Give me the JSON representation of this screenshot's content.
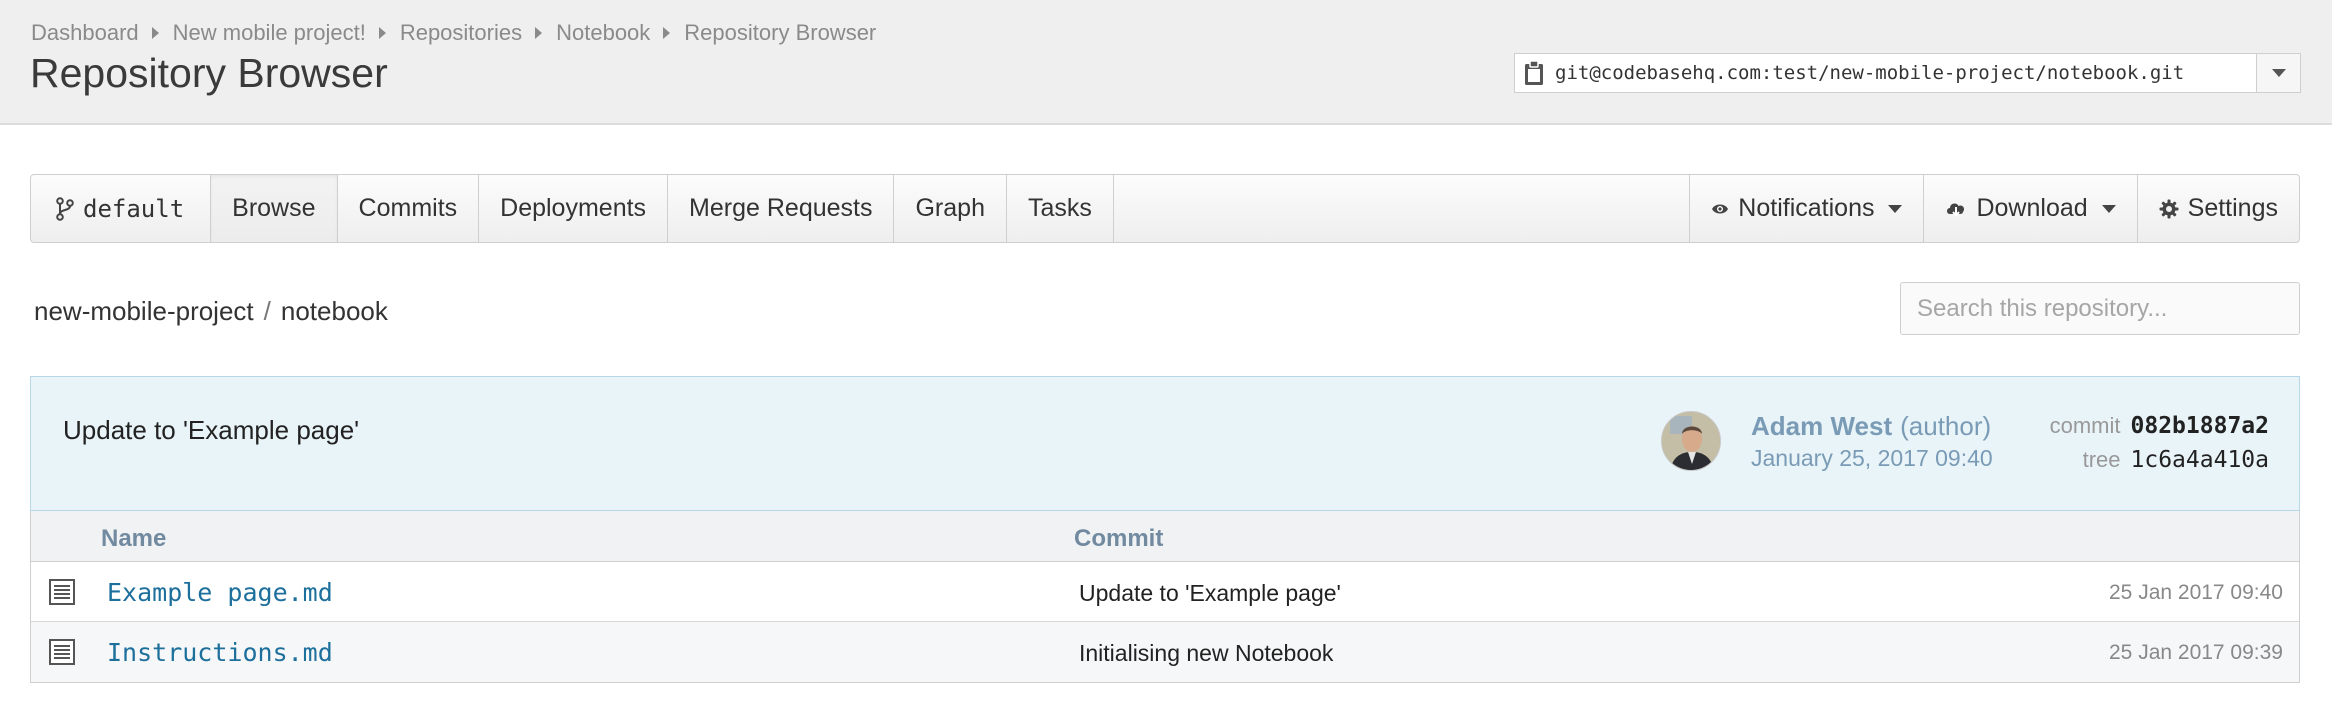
{
  "breadcrumb": [
    "Dashboard",
    "New mobile project!",
    "Repositories",
    "Notebook",
    "Repository Browser"
  ],
  "page_title": "Repository Browser",
  "clone": {
    "url": "git@codebasehq.com:test/new-mobile-project/notebook.git",
    "clip_icon": "clipboard-icon",
    "dropdown_icon": "caret-down-icon"
  },
  "nav": {
    "branch": "default",
    "branch_icon": "git-branch-icon",
    "tabs": [
      "Browse",
      "Commits",
      "Deployments",
      "Merge Requests",
      "Graph",
      "Tasks"
    ],
    "active_tab": "Browse",
    "notifications": "Notifications",
    "notifications_icon": "eye-icon",
    "download": "Download",
    "download_icon": "cloud-download-icon",
    "settings": "Settings",
    "settings_icon": "gear-icon"
  },
  "path": {
    "project": "new-mobile-project",
    "separator": "/",
    "repo": "notebook"
  },
  "search": {
    "placeholder": "Search this repository..."
  },
  "commit": {
    "message": "Update to 'Example page'",
    "author": "Adam West",
    "role": "(author)",
    "date": "January 25, 2017 09:40",
    "commit_label": "commit",
    "commit_hash": "082b1887a2",
    "tree_label": "tree",
    "tree_hash": "1c6a4a410a"
  },
  "table": {
    "headers": {
      "name": "Name",
      "commit": "Commit"
    },
    "rows": [
      {
        "name": "Example page.md",
        "commit": "Update to 'Example page'",
        "date": "25 Jan 2017 09:40"
      },
      {
        "name": "Instructions.md",
        "commit": "Initialising new Notebook",
        "date": "25 Jan 2017 09:39"
      }
    ]
  },
  "colors": {
    "header_bg": "#efefef",
    "commit_panel_bg": "#e9f4f9",
    "link": "#1d6f9c",
    "author": "#7a9bb5"
  }
}
